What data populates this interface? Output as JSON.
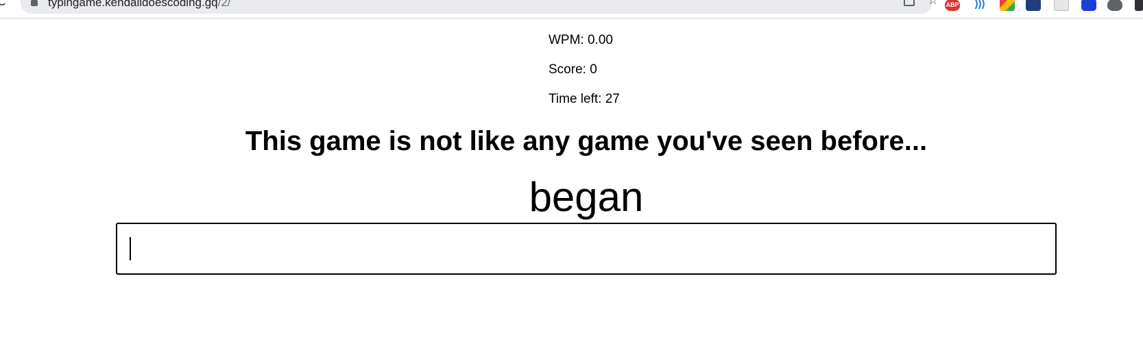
{
  "browser": {
    "url_host": "typingame.kendalldoescoding.gq",
    "url_path": "/2/",
    "extensions": [
      {
        "name": "adblock-plus",
        "label": "ABP"
      },
      {
        "name": "wave-extension",
        "label": ")))"
      },
      {
        "name": "grid-extension",
        "label": ""
      },
      {
        "name": "checklist-extension",
        "label": ""
      },
      {
        "name": "document-extension",
        "label": ""
      },
      {
        "name": "video-extension",
        "label": ""
      },
      {
        "name": "puppy-extension",
        "label": ""
      },
      {
        "name": "extensions-menu",
        "label": ""
      }
    ]
  },
  "game": {
    "wpm_text": "WPM: 0.00",
    "score_text": "Score: 0",
    "time_text": "Time left: 27",
    "headline": "This game is not like any game you've seen before...",
    "current_word": "began",
    "input_value": ""
  }
}
